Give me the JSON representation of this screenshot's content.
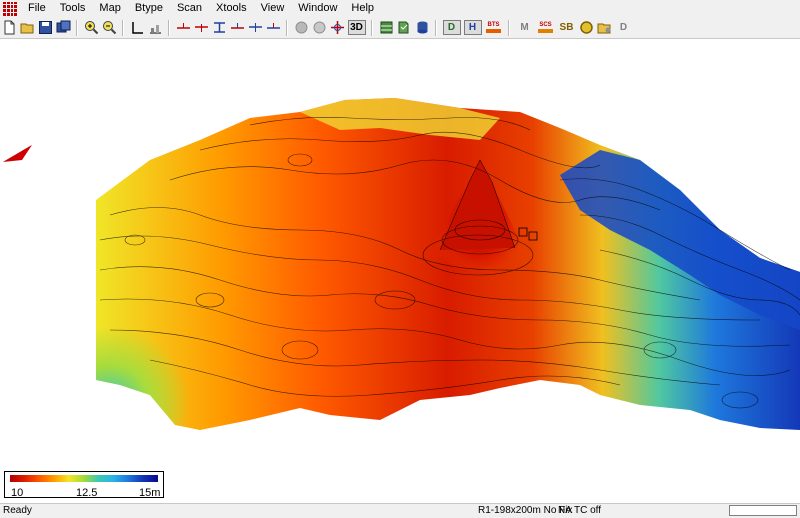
{
  "menu": {
    "items": [
      {
        "label": "File"
      },
      {
        "label": "Tools"
      },
      {
        "label": "Map"
      },
      {
        "label": "Btype"
      },
      {
        "label": "Scan"
      },
      {
        "label": "Xtools"
      },
      {
        "label": "View"
      },
      {
        "label": "Window"
      },
      {
        "label": "Help"
      }
    ]
  },
  "toolbar": {
    "buttons": [
      {
        "icon": "new-file-icon"
      },
      {
        "icon": "open-folder-icon"
      },
      {
        "icon": "save-icon"
      },
      {
        "icon": "save-all-icon"
      },
      {
        "icon": "zoom-in-icon"
      },
      {
        "icon": "zoom-out-icon"
      },
      {
        "icon": "axis-icon"
      },
      {
        "icon": "chart-icon"
      },
      {
        "icon": "marker-1-icon"
      },
      {
        "icon": "marker-2-icon"
      },
      {
        "icon": "marker-3-icon"
      },
      {
        "icon": "marker-4-icon"
      },
      {
        "icon": "marker-5-icon"
      },
      {
        "icon": "marker-6-icon"
      },
      {
        "icon": "sphere-1-icon"
      },
      {
        "icon": "sphere-2-icon"
      },
      {
        "icon": "target-icon"
      },
      {
        "icon": "view-3d-icon"
      },
      {
        "icon": "grid-icon"
      },
      {
        "icon": "survey-icon"
      },
      {
        "icon": "database-icon"
      },
      {
        "icon": "d-mode-icon"
      },
      {
        "icon": "h-mode-icon"
      },
      {
        "icon": "bathymetry-icon"
      },
      {
        "icon": "m-icon"
      },
      {
        "icon": "scs-icon"
      },
      {
        "icon": "sb-icon"
      },
      {
        "icon": "circle-icon"
      },
      {
        "icon": "folder-settings-icon"
      },
      {
        "icon": "document-icon"
      }
    ],
    "label_3d": "3D",
    "label_d": "D",
    "label_h": "H",
    "label_bts": "BTS",
    "label_m": "M",
    "label_scs": "SCS",
    "label_sb": "SB",
    "label_doc": "D"
  },
  "legend": {
    "min_label": "10",
    "mid_label": "12.5",
    "max_label": "15m"
  },
  "status": {
    "ready": "Ready",
    "info": "R1-198x200m No Fix",
    "na": "NA",
    "tc": "TC off"
  },
  "colors": {
    "menu_bg": "#f0f0f0",
    "deep_red": "#c81400",
    "deep_blue": "#0a28b4"
  }
}
